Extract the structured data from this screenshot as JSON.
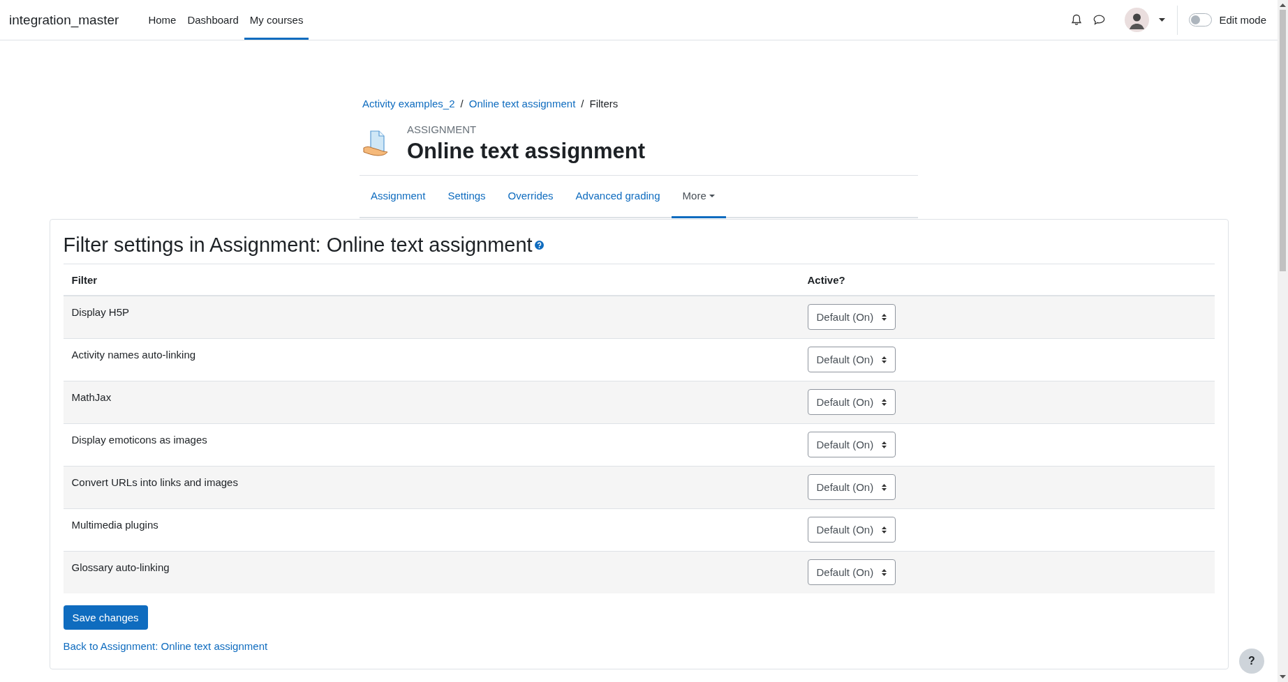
{
  "navbar": {
    "site_name": "integration_master",
    "links": [
      {
        "label": "Home",
        "selected": false
      },
      {
        "label": "Dashboard",
        "selected": false
      },
      {
        "label": "My courses",
        "selected": true
      }
    ],
    "edit_mode": {
      "label": "Edit mode",
      "on": false
    }
  },
  "breadcrumb_separator": "/",
  "breadcrumb": [
    {
      "label": "Activity examples_2",
      "kind": "link"
    },
    {
      "label": "Online text assignment",
      "kind": "link"
    },
    {
      "label": "Filters",
      "kind": "current"
    }
  ],
  "header": {
    "kicker": "ASSIGNMENT",
    "title": "Online text assignment"
  },
  "tabs": [
    {
      "label": "Assignment",
      "selected": false,
      "dropdown": false
    },
    {
      "label": "Settings",
      "selected": false,
      "dropdown": false
    },
    {
      "label": "Overrides",
      "selected": false,
      "dropdown": false
    },
    {
      "label": "Advanced grading",
      "selected": false,
      "dropdown": false
    },
    {
      "label": "More",
      "selected": true,
      "dropdown": true
    }
  ],
  "page_title": "Filter settings in Assignment: Online text assignment",
  "table": {
    "columns": [
      "Filter",
      "Active?"
    ],
    "rows": [
      {
        "filter": "Display H5P",
        "active": "Default (On)"
      },
      {
        "filter": "Activity names auto-linking",
        "active": "Default (On)"
      },
      {
        "filter": "MathJax",
        "active": "Default (On)"
      },
      {
        "filter": "Display emoticons as images",
        "active": "Default (On)"
      },
      {
        "filter": "Convert URLs into links and images",
        "active": "Default (On)"
      },
      {
        "filter": "Multimedia plugins",
        "active": "Default (On)"
      },
      {
        "filter": "Glossary auto-linking",
        "active": "Default (On)"
      }
    ]
  },
  "save_button": "Save changes",
  "back_link": "Back to Assignment: Online text assignment",
  "help_button": "?"
}
